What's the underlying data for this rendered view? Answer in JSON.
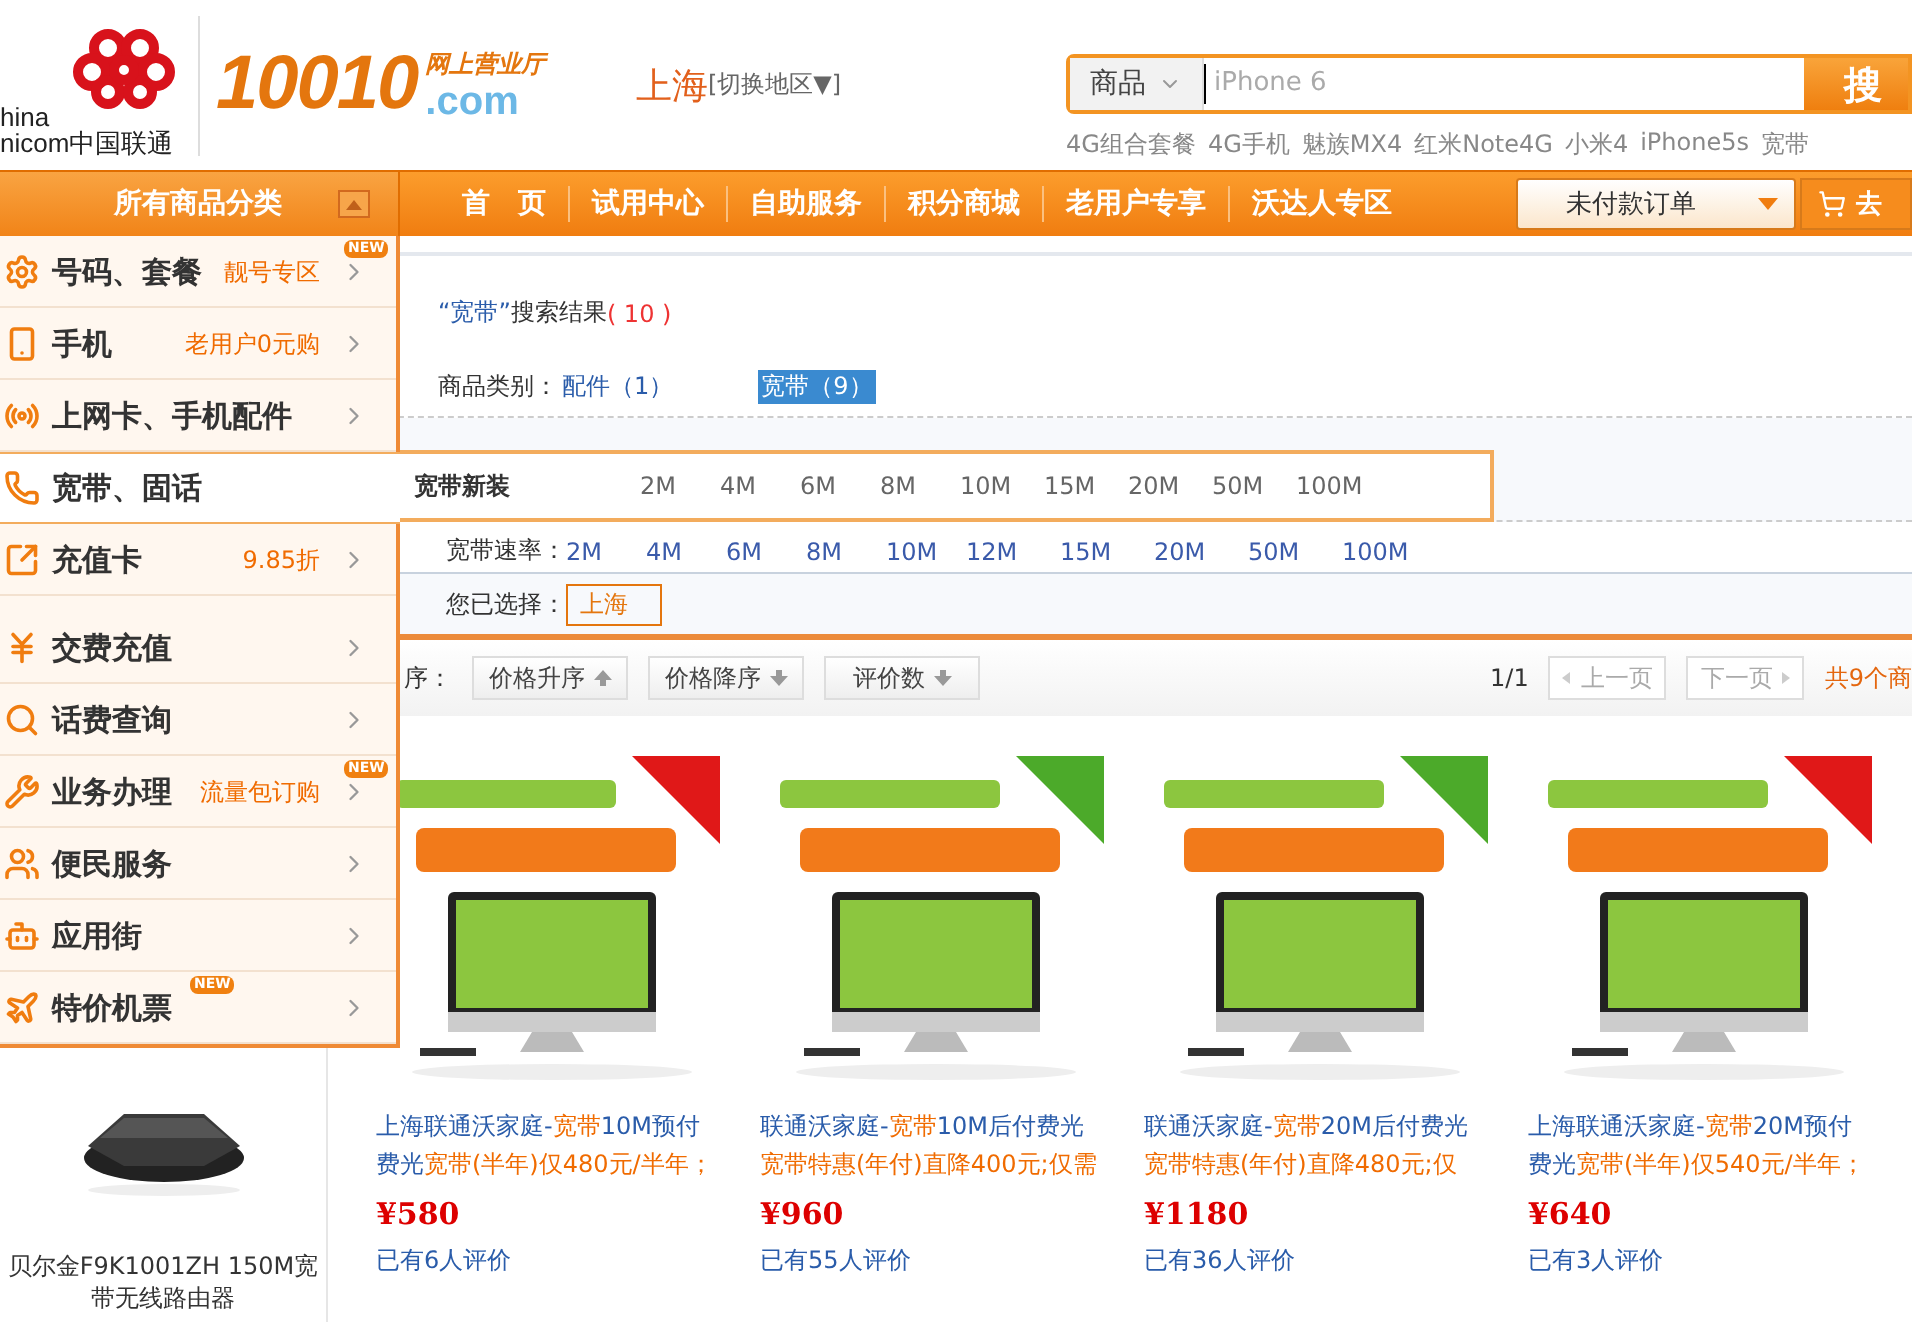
{
  "header": {
    "logo": {
      "line1": "hina",
      "line2": "nicom中国联通"
    },
    "site_logo": {
      "number": "10010",
      "tagline": "网上营业厅",
      "domain": ".com"
    },
    "city": "上海",
    "switch_city": "[切换地区▼]",
    "search": {
      "category": "商品",
      "placeholder": "iPhone 6",
      "button": "搜"
    },
    "hot_words": [
      "4G组合套餐",
      "4G手机",
      "魅族MX4",
      "红米Note4G",
      "小米4",
      "iPhone5s",
      "宽带"
    ]
  },
  "nav": {
    "all_categories": "所有商品分类",
    "items": [
      "首　页",
      "试用中心",
      "自助服务",
      "积分商城",
      "老用户专享",
      "沃达人专区"
    ],
    "orders_dropdown": "未付款订单",
    "cart_button": "去"
  },
  "category_menu": {
    "groups": [
      [
        {
          "label": "号码、套餐",
          "promo": "靓号专区",
          "badge": "NEW",
          "selected": false
        },
        {
          "label": "手机",
          "promo": "老用户0元购",
          "selected": false
        },
        {
          "label": "上网卡、手机配件",
          "selected": false
        },
        {
          "label": "宽带、固话",
          "selected": true,
          "flyout": {
            "title": "宽带新装",
            "options": [
              "2M",
              "4M",
              "6M",
              "8M",
              "10M",
              "15M",
              "20M",
              "50M",
              "100M"
            ]
          }
        },
        {
          "label": "充值卡",
          "promo": "9.85折",
          "selected": false
        }
      ],
      [
        {
          "label": "交费充值",
          "selected": false
        },
        {
          "label": "话费查询",
          "selected": false
        },
        {
          "label": "业务办理",
          "promo": "流量包订购",
          "badge": "NEW",
          "selected": false
        },
        {
          "label": "便民服务",
          "selected": false
        },
        {
          "label": "应用街",
          "selected": false
        },
        {
          "label": "特价机票",
          "badge": "NEW",
          "selected": false
        }
      ]
    ]
  },
  "results": {
    "query": "“宽带”",
    "heading": "搜索结果",
    "count": "( 10 )",
    "category_filter": {
      "label": "商品类别：",
      "options": [
        {
          "label": "配件（1）",
          "selected": false
        },
        {
          "label": "宽带（9）",
          "selected": true
        }
      ]
    },
    "speed_filter": {
      "label": "宽带速率：",
      "options": [
        "2M",
        "4M",
        "6M",
        "8M",
        "10M",
        "12M",
        "15M",
        "20M",
        "50M",
        "100M"
      ]
    },
    "chosen": {
      "label": "您已选择：",
      "tags": [
        "上海"
      ]
    }
  },
  "sort_bar": {
    "label": "序：",
    "buttons": [
      {
        "label": "价格升序",
        "kind": "up"
      },
      {
        "label": "价格降序",
        "kind": "down"
      },
      {
        "label": "评价数",
        "kind": "down"
      }
    ],
    "page": "1/1",
    "prev": "上一页",
    "next": "下一页",
    "total": "共9个商"
  },
  "side_product": {
    "title": "贝尔金F9K1001ZH 150M宽带无线路由器"
  },
  "products": [
    {
      "title": [
        {
          "text": "上海联通沃家庭-",
          "highlight": false
        },
        {
          "text": "宽带",
          "highlight": true
        },
        {
          "text": "10M预付费光",
          "highlight": false
        },
        {
          "text": "宽带",
          "highlight": true
        },
        {
          "text": "(半年)仅480元/半年；",
          "highlight": true
        }
      ],
      "price": "¥580",
      "reviews": "已有6人评价"
    },
    {
      "title": [
        {
          "text": "联通沃家庭-",
          "highlight": false
        },
        {
          "text": "宽带",
          "highlight": true
        },
        {
          "text": "10M后付费光",
          "highlight": false
        },
        {
          "text": "宽带特惠(年付)直降400元;仅需",
          "highlight": true
        }
      ],
      "price": "¥960",
      "reviews": "已有55人评价"
    },
    {
      "title": [
        {
          "text": "联通沃家庭-",
          "highlight": false
        },
        {
          "text": "宽带",
          "highlight": true
        },
        {
          "text": "20M后付费光",
          "highlight": false
        },
        {
          "text": "宽带特惠(年付)直降480元;仅",
          "highlight": true
        }
      ],
      "price": "¥1180",
      "reviews": "已有36人评价"
    },
    {
      "title": [
        {
          "text": "上海联通沃家庭-",
          "highlight": false
        },
        {
          "text": "宽带",
          "highlight": true
        },
        {
          "text": "20M预付费光",
          "highlight": false
        },
        {
          "text": "宽带",
          "highlight": true
        },
        {
          "text": "(半年)仅540元/半年；",
          "highlight": true
        }
      ],
      "price": "¥640",
      "reviews": "已有3人评价"
    }
  ]
}
